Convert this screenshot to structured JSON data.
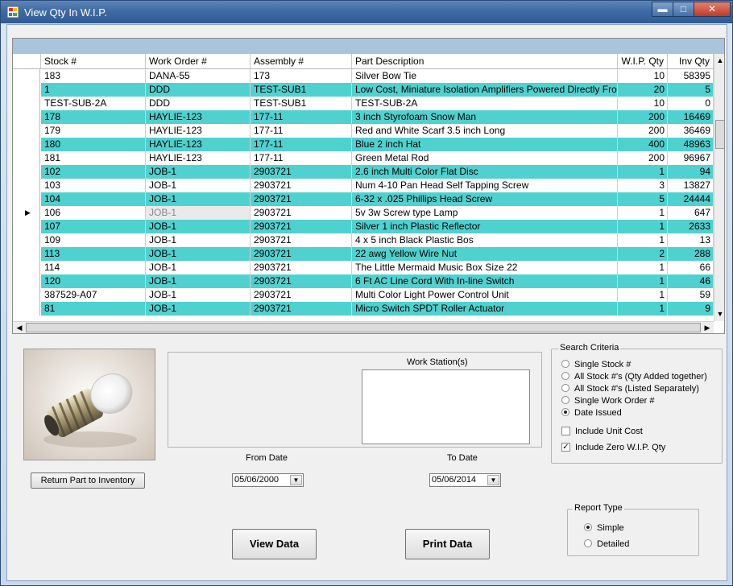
{
  "window": {
    "title": "View Qty In W.I.P.",
    "min_label": "▬",
    "max_label": "□",
    "close_label": "✕"
  },
  "grid": {
    "columns": [
      "Stock #",
      "Work Order #",
      "Assembly #",
      "Part Description",
      "W.I.P. Qty",
      "Inv Qty"
    ],
    "rows": [
      {
        "stock": "183",
        "wo": "DANA-55",
        "asm": "173",
        "desc": "Silver Bow Tie",
        "wip": "10",
        "inv": "58395",
        "teal": false
      },
      {
        "stock": "1",
        "wo": "DDD",
        "asm": "TEST-SUB1",
        "desc": "Low Cost, Miniature Isolation Amplifiers Powered Directly From",
        "wip": "20",
        "inv": "5",
        "teal": true
      },
      {
        "stock": "TEST-SUB-2A",
        "wo": "DDD",
        "asm": "TEST-SUB1",
        "desc": "TEST-SUB-2A",
        "wip": "10",
        "inv": "0",
        "teal": false
      },
      {
        "stock": "178",
        "wo": "HAYLIE-123",
        "asm": "177-11",
        "desc": "3 inch Styrofoam Snow Man",
        "wip": "200",
        "inv": "16469",
        "teal": true
      },
      {
        "stock": "179",
        "wo": "HAYLIE-123",
        "asm": "177-11",
        "desc": "Red and White Scarf 3.5 inch Long",
        "wip": "200",
        "inv": "36469",
        "teal": false
      },
      {
        "stock": "180",
        "wo": "HAYLIE-123",
        "asm": "177-11",
        "desc": "Blue 2 inch Hat",
        "wip": "400",
        "inv": "48963",
        "teal": true
      },
      {
        "stock": "181",
        "wo": "HAYLIE-123",
        "asm": "177-11",
        "desc": "Green Metal Rod",
        "wip": "200",
        "inv": "96967",
        "teal": false
      },
      {
        "stock": "102",
        "wo": "JOB-1",
        "asm": "2903721",
        "desc": "2.6 inch Multi Color Flat Disc",
        "wip": "1",
        "inv": "94",
        "teal": true
      },
      {
        "stock": "103",
        "wo": "JOB-1",
        "asm": "2903721",
        "desc": "Num 4-10  Pan Head Self Tapping Screw",
        "wip": "3",
        "inv": "13827",
        "teal": false
      },
      {
        "stock": "104",
        "wo": "JOB-1",
        "asm": "2903721",
        "desc": "6-32 x .025 Phillips Head Screw",
        "wip": "5",
        "inv": "24444",
        "teal": true
      },
      {
        "stock": "106",
        "wo": "JOB-1",
        "asm": "2903721",
        "desc": "5v 3w Screw type Lamp",
        "wip": "1",
        "inv": "647",
        "teal": false,
        "current": true
      },
      {
        "stock": "107",
        "wo": "JOB-1",
        "asm": "2903721",
        "desc": "Silver 1 inch Plastic Reflector",
        "wip": "1",
        "inv": "2633",
        "teal": true
      },
      {
        "stock": "109",
        "wo": "JOB-1",
        "asm": "2903721",
        "desc": "4 x 5 inch Black Plastic Bos",
        "wip": "1",
        "inv": "13",
        "teal": false
      },
      {
        "stock": "113",
        "wo": "JOB-1",
        "asm": "2903721",
        "desc": "22 awg Yellow Wire Nut",
        "wip": "2",
        "inv": "288",
        "teal": true
      },
      {
        "stock": "114",
        "wo": "JOB-1",
        "asm": "2903721",
        "desc": "The Little Mermaid Music Box Size 22",
        "wip": "1",
        "inv": "66",
        "teal": false
      },
      {
        "stock": "120",
        "wo": "JOB-1",
        "asm": "2903721",
        "desc": "6 Ft AC Line Cord With In-line Switch",
        "wip": "1",
        "inv": "46",
        "teal": true
      },
      {
        "stock": "387529-A07",
        "wo": "JOB-1",
        "asm": "2903721",
        "desc": "Multi Color Light Power Control Unit",
        "wip": "1",
        "inv": "59",
        "teal": false
      },
      {
        "stock": "81",
        "wo": "JOB-1",
        "asm": "2903721",
        "desc": "Micro Switch SPDT Roller Actuator",
        "wip": "1",
        "inv": "9",
        "teal": true
      }
    ],
    "current_marker": "▶"
  },
  "buttons": {
    "return_part": "Return Part to Inventory",
    "view_data": "View Data",
    "print_data": "Print Data"
  },
  "workstation": {
    "label": "Work Station(s)"
  },
  "search": {
    "legend": "Search Criteria",
    "options": [
      "Single Stock #",
      "All Stock #'s (Qty Added together)",
      "All Stock #'s (Listed Separately)",
      "Single Work Order #",
      "Date Issued"
    ],
    "selected_index": 4,
    "include_unit_cost": {
      "label": "Include Unit Cost",
      "checked": false
    },
    "include_zero_wip": {
      "label": "Include Zero W.I.P. Qty",
      "checked": true
    }
  },
  "dates": {
    "from_label": "From Date",
    "from_value": "05/06/2000",
    "to_label": "To Date",
    "to_value": "05/06/2014"
  },
  "report": {
    "legend": "Report Type",
    "options": [
      "Simple",
      "Detailed"
    ],
    "selected_index": 0
  }
}
